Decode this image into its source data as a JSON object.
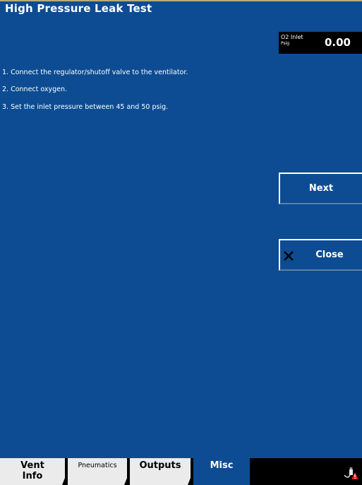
{
  "header": {
    "title": "High Pressure Leak Test"
  },
  "reading": {
    "label": "O2 Inlet",
    "unit": "Psig",
    "value": "0.00"
  },
  "instructions": [
    "1. Connect the regulator/shutoff valve to the ventilator.",
    "2. Connect oxygen.",
    "3. Set the inlet pressure between 45 and 50 psig."
  ],
  "buttons": {
    "next_label": "Next",
    "close_label": "Close"
  },
  "tabs": [
    {
      "line1": "Vent",
      "line2": "Info"
    },
    {
      "line1": "Pneumatics"
    },
    {
      "line1": "Outputs"
    },
    {
      "line1": "Misc"
    }
  ],
  "icons": {
    "close": "close-icon",
    "status": "plug-warning-icon"
  },
  "colors": {
    "background": "#0d4c92",
    "title_stripe": "#b5ad78",
    "tab_inactive": "#ebebeb",
    "tab_active": "#0d4c92",
    "warning": "#e0201b"
  }
}
